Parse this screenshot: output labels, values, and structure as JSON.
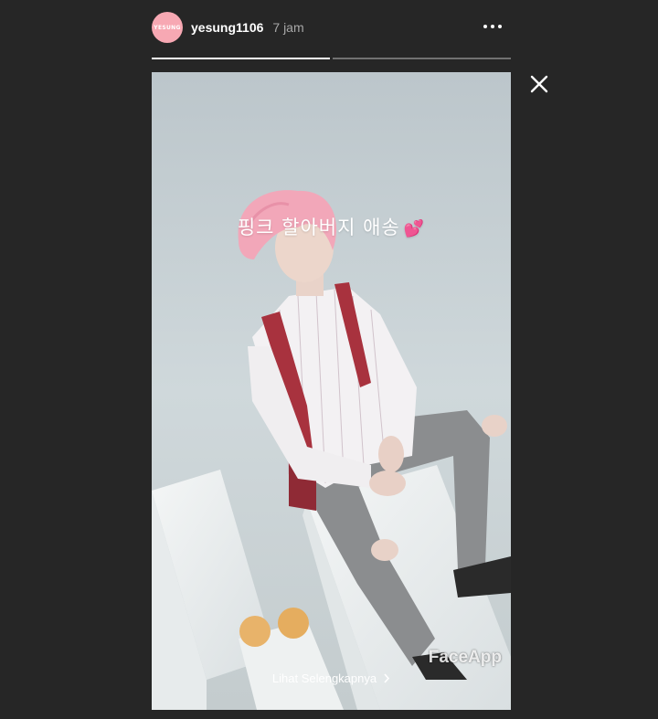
{
  "header": {
    "avatar_text": "YESUNG",
    "username": "yesung1106",
    "timestamp": "7 jam",
    "more_icon": "more-horizontal-icon"
  },
  "progress": {
    "segments": [
      1.0,
      0.0
    ]
  },
  "story": {
    "caption": "핑크 할아버지 애송",
    "caption_emoji": "💕",
    "watermark": "FaceApp",
    "see_more_label": "Lihat Selengkapnya",
    "see_more_icon": "chevron-right-icon"
  },
  "controls": {
    "close_icon": "close-icon"
  },
  "colors": {
    "background": "#262626",
    "avatar": "#f7a8b3",
    "timestamp": "#a8a8a8",
    "backdrop": "#c9d2d6",
    "hair": "#f2a7b9",
    "suspenders": "#a8323e"
  }
}
